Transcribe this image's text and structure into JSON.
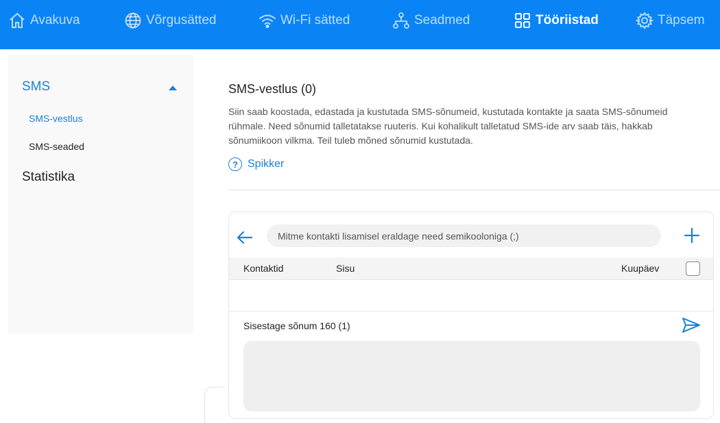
{
  "nav": {
    "items": [
      {
        "label": "Avakuva",
        "icon": "home-icon"
      },
      {
        "label": "Võrgusätted",
        "icon": "globe-icon"
      },
      {
        "label": "Wi-Fi sätted",
        "icon": "wifi-icon"
      },
      {
        "label": "Seadmed",
        "icon": "devices-icon"
      },
      {
        "label": "Tööriistad",
        "icon": "tools-icon"
      },
      {
        "label": "Täpsem",
        "icon": "gear-icon"
      }
    ],
    "active": "Tööriistad",
    "color": "#0a84f5"
  },
  "sidebar": {
    "sms_group": "SMS",
    "sms_items": [
      {
        "label": "SMS-vestlus"
      },
      {
        "label": "SMS-seaded"
      }
    ],
    "statistics": "Statistika"
  },
  "main": {
    "title": "SMS-vestlus (0)",
    "description": "Siin saab koostada, edastada ja kustutada SMS-sõnumeid, kustutada kontakte ja saata SMS-sõnumeid rühmale. Need sõnumid talletatakse ruuteris. Kui kohalikult talletatud SMS-ide arv saab täis, hakkab sõnumiikoon vilkma. Teil tuleb mõned sõnumid kustutada.",
    "help": "Spikker"
  },
  "panel": {
    "contact_placeholder": "Mitme kontakti lisamisel eraldage need semikooloniga (;)",
    "columns": {
      "contacts": "Kontaktid",
      "content": "Sisu",
      "date": "Kuupäev"
    },
    "message_label": "Sisestage sõnum 160 (1)"
  },
  "accent": "#1a7fd8"
}
